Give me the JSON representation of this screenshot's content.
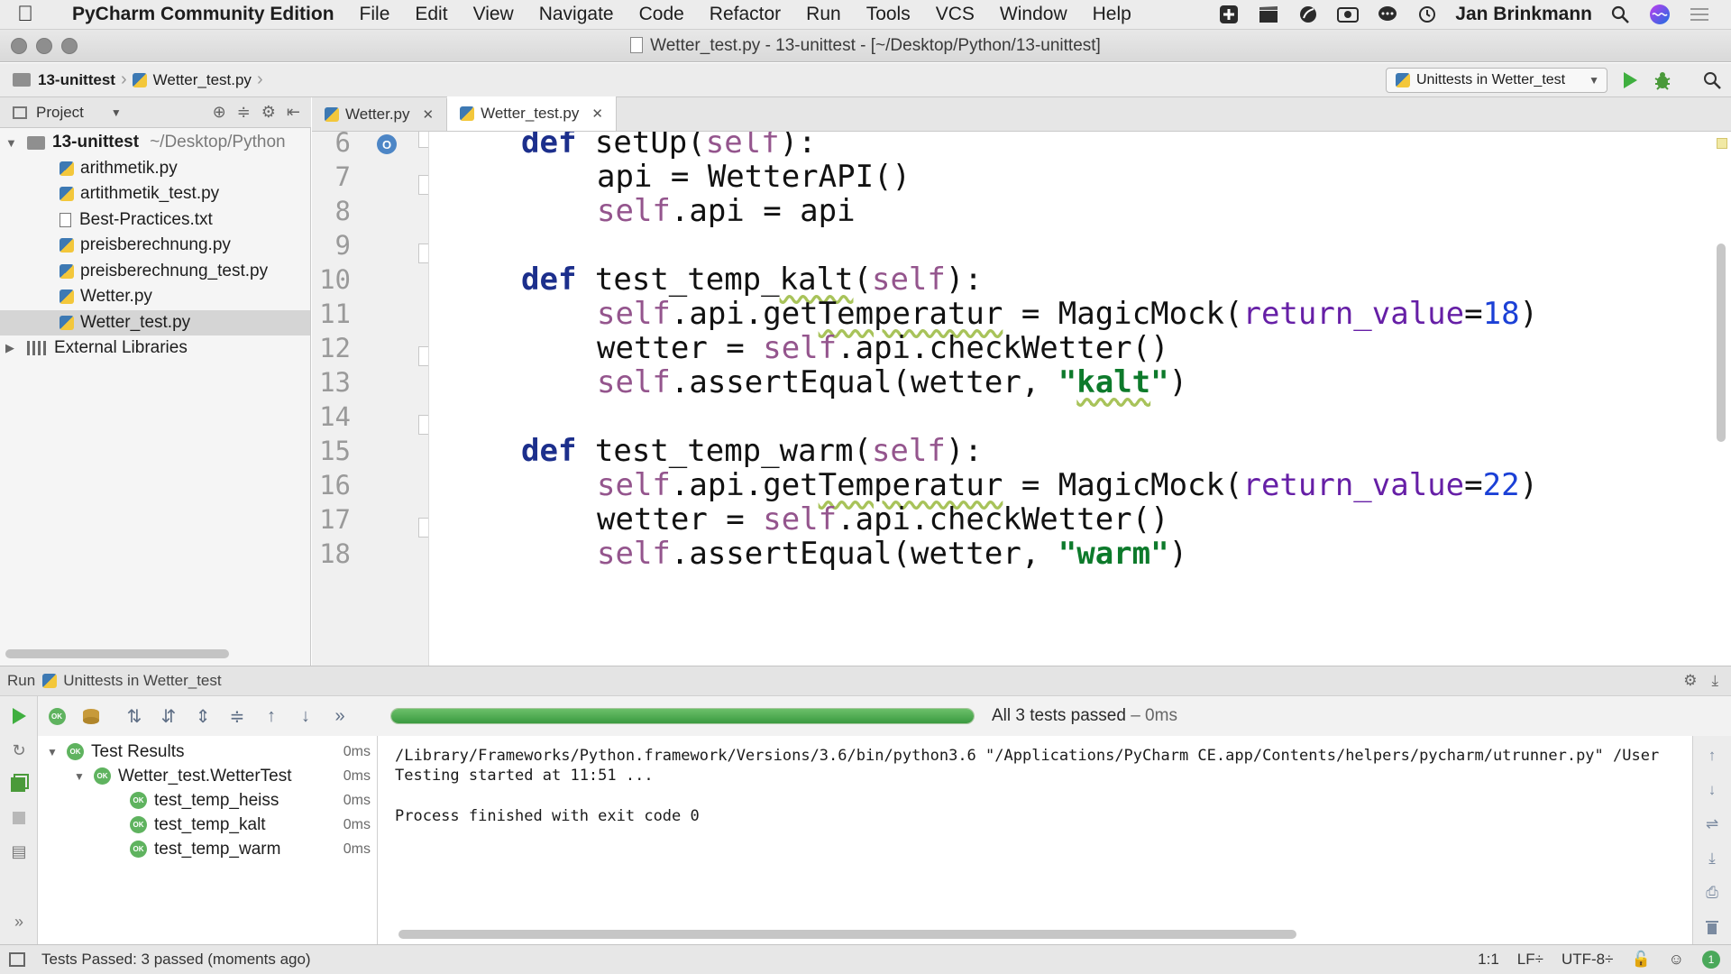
{
  "menubar": {
    "app_name": "PyCharm Community Edition",
    "items": [
      "File",
      "Edit",
      "View",
      "Navigate",
      "Code",
      "Refactor",
      "Run",
      "Tools",
      "VCS",
      "Window",
      "Help"
    ],
    "user": "Jan Brinkmann"
  },
  "window": {
    "title": "Wetter_test.py - 13-unittest - [~/Desktop/Python/13-unittest]"
  },
  "navbar": {
    "breadcrumb_project": "13-unittest",
    "breadcrumb_file": "Wetter_test.py",
    "run_config": "Unittests in Wetter_test"
  },
  "project_panel": {
    "label": "Project",
    "root_name": "13-unittest",
    "root_path": "~/Desktop/Python",
    "files": [
      "arithmetik.py",
      "artithmetik_test.py",
      "Best-Practices.txt",
      "preisberechnung.py",
      "preisberechnung_test.py",
      "Wetter.py",
      "Wetter_test.py"
    ],
    "external": "External Libraries"
  },
  "editor": {
    "tabs": [
      "Wetter.py",
      "Wetter_test.py"
    ],
    "line_numbers": [
      "6",
      "7",
      "8",
      "9",
      "10",
      "11",
      "12",
      "13",
      "14",
      "15",
      "16",
      "17",
      "18"
    ],
    "code": {
      "l6_def": "def",
      "l6_name": "setUp(",
      "l6_self": "self",
      "l6_end": "):",
      "l7": "api = WetterAPI()",
      "l8_self": "self",
      "l8_rest": ".api = api",
      "l10_def": "def",
      "l10_name_a": "test_temp_",
      "l10_name_b": "kalt",
      "l10_open": "(",
      "l10_self": "self",
      "l10_end": "):",
      "l11_self": "self",
      "l11_a": ".api.get",
      "l11_b": "Temperatur",
      "l11_c": " = MagicMock(",
      "l11_kw": "return_value",
      "l11_eq": "=",
      "l11_num": "18",
      "l11_end": ")",
      "l12_a": "wetter = ",
      "l12_self": "self",
      "l12_b": ".api.checkWetter()",
      "l13_self": "self",
      "l13_a": ".assertEqual(wetter, ",
      "l13_q1": "\"",
      "l13_str": "kalt",
      "l13_q2": "\"",
      "l13_end": ")",
      "l15_def": "def",
      "l15_name": "test_temp_warm(",
      "l15_self": "self",
      "l15_end": "):",
      "l16_self": "self",
      "l16_a": ".api.get",
      "l16_b": "Temperatur",
      "l16_c": " = MagicMock(",
      "l16_kw": "return_value",
      "l16_eq": "=",
      "l16_num": "22",
      "l16_end": ")",
      "l17_a": "wetter = ",
      "l17_self": "self",
      "l17_b": ".api.checkWetter()",
      "l18_self": "self",
      "l18_a": ".assertEqual(wetter, ",
      "l18_str": "\"warm\"",
      "l18_end": ")"
    }
  },
  "run_panel": {
    "label": "Run",
    "config": "Unittests in Wetter_test",
    "progress": 1.0,
    "summary_main": "All 3 tests passed",
    "summary_time": " – 0ms",
    "tests": [
      {
        "name": "Test Results",
        "duration": "0ms"
      },
      {
        "name": "Wetter_test.WetterTest",
        "duration": "0ms"
      },
      {
        "name": "test_temp_heiss",
        "duration": "0ms"
      },
      {
        "name": "test_temp_kalt",
        "duration": "0ms"
      },
      {
        "name": "test_temp_warm",
        "duration": "0ms"
      }
    ],
    "ok_badge": "OK",
    "console": [
      "/Library/Frameworks/Python.framework/Versions/3.6/bin/python3.6 \"/Applications/PyCharm CE.app/Contents/helpers/pycharm/utrunner.py\" /User",
      "Testing started at 11:51 ...",
      "Process finished with exit code 0"
    ]
  },
  "statusbar": {
    "message": "Tests Passed: 3 passed (moments ago)",
    "position": "1:1",
    "line_sep": "LF÷",
    "encoding": "UTF-8÷"
  },
  "colors": {
    "keyword": "#1c2f8c",
    "self": "#94558d",
    "string": "#0d7a2b",
    "number": "#1b40d6",
    "progress": "#4caf50"
  }
}
